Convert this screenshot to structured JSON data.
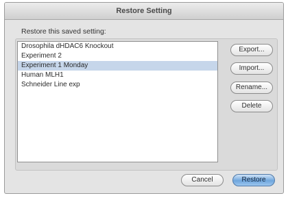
{
  "window": {
    "title": "Restore Setting"
  },
  "prompt": "Restore this saved setting:",
  "settings_list": {
    "items": [
      "Drosophila dHDAC6 Knockout",
      "Experiment 2",
      "Experiment 1 Monday",
      "Human MLH1",
      "Schneider Line exp"
    ],
    "selected_index": 2,
    "selection_color": "#c6d6ea"
  },
  "side_buttons": {
    "export": "Export...",
    "import": "Import...",
    "rename": "Rename...",
    "delete": "Delete"
  },
  "footer": {
    "cancel": "Cancel",
    "restore": "Restore"
  },
  "colors": {
    "default_button": "#6fa6dd"
  }
}
